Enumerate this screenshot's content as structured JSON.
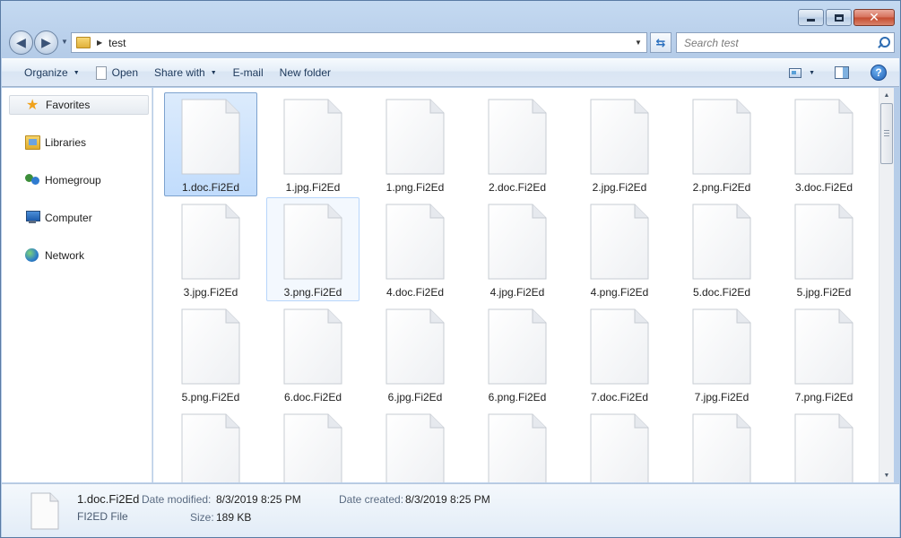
{
  "window": {
    "address": {
      "breadcrumb": [
        "test"
      ]
    },
    "search": {
      "placeholder": "Search test"
    }
  },
  "toolbar": {
    "organize_label": "Organize",
    "open_label": "Open",
    "share_label": "Share with",
    "email_label": "E-mail",
    "new_folder_label": "New folder"
  },
  "navpane": {
    "items": [
      {
        "label": "Favorites",
        "icon": "star-icon"
      },
      {
        "label": "Libraries",
        "icon": "libraries-icon"
      },
      {
        "label": "Homegroup",
        "icon": "homegroup-icon"
      },
      {
        "label": "Computer",
        "icon": "computer-icon"
      },
      {
        "label": "Network",
        "icon": "network-icon"
      }
    ]
  },
  "files": [
    "1.doc.Fi2Ed",
    "1.jpg.Fi2Ed",
    "1.png.Fi2Ed",
    "2.doc.Fi2Ed",
    "2.jpg.Fi2Ed",
    "2.png.Fi2Ed",
    "3.doc.Fi2Ed",
    "3.jpg.Fi2Ed",
    "3.png.Fi2Ed",
    "4.doc.Fi2Ed",
    "4.jpg.Fi2Ed",
    "4.png.Fi2Ed",
    "5.doc.Fi2Ed",
    "5.jpg.Fi2Ed",
    "5.png.Fi2Ed",
    "6.doc.Fi2Ed",
    "6.jpg.Fi2Ed",
    "6.png.Fi2Ed",
    "7.doc.Fi2Ed",
    "7.jpg.Fi2Ed",
    "7.png.Fi2Ed",
    "",
    "",
    "",
    "",
    "",
    "",
    ""
  ],
  "selected_file": "1.doc.Fi2Ed",
  "hovered_file": "3.png.Fi2Ed",
  "details": {
    "name": "1.doc.Fi2Ed",
    "type": "FI2ED File",
    "date_modified_label": "Date modified:",
    "date_modified": "8/3/2019 8:25 PM",
    "date_created_label": "Date created:",
    "date_created": "8/3/2019 8:25 PM",
    "size_label": "Size:",
    "size": "189 KB"
  },
  "colors": {
    "selection": "#c1dcfc",
    "frame": "#b9cfea",
    "accent": "#2f6db2"
  }
}
